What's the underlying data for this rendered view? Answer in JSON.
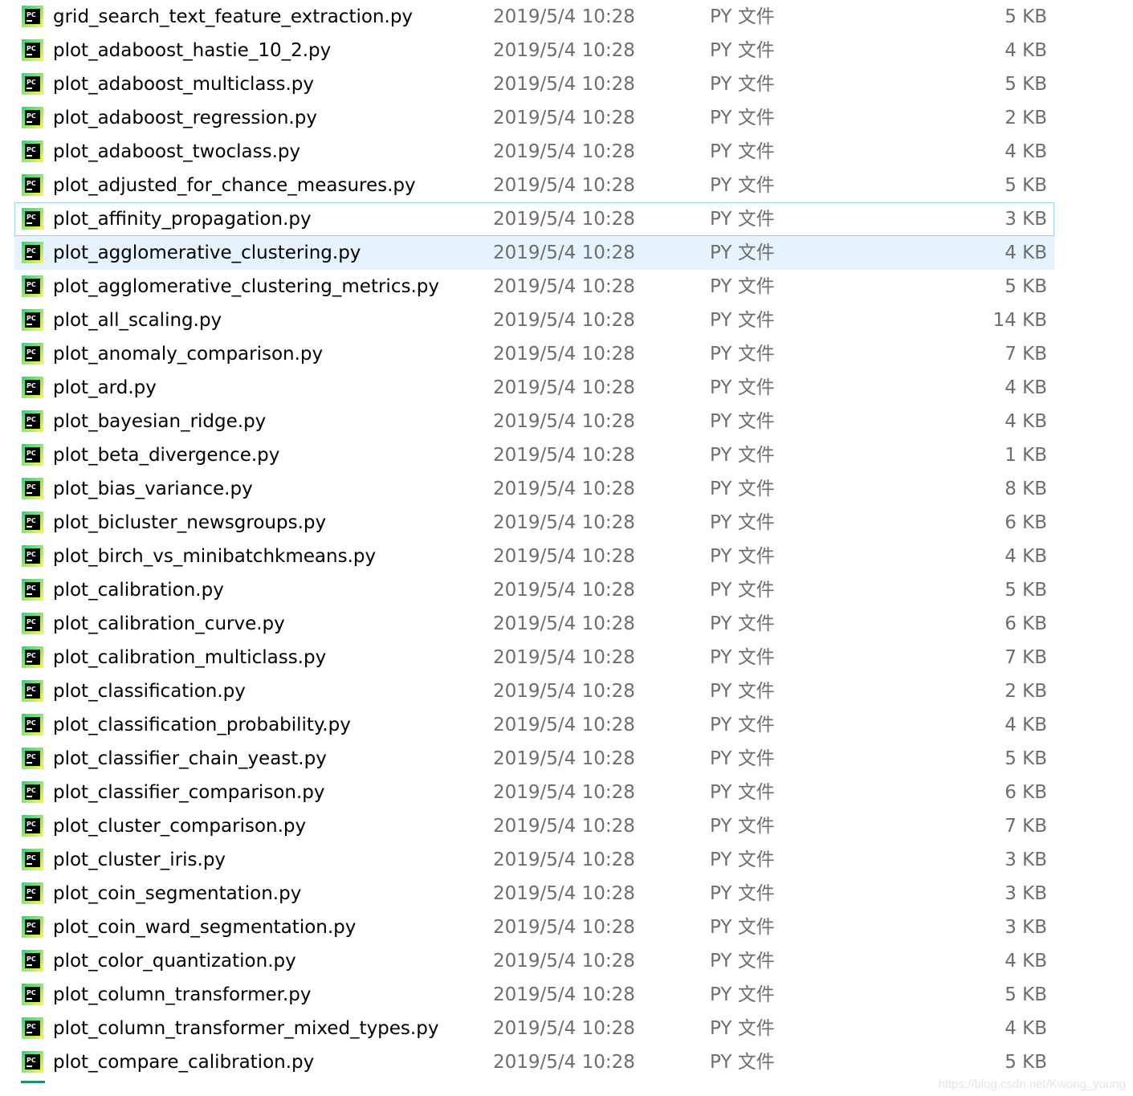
{
  "colors": {
    "focus_border": "#99d1ff",
    "hover_background": "#e5f3ff",
    "name_text": "#000000",
    "detail_text": "#6d6d6d",
    "icon_gradient_top": "#21d789",
    "icon_gradient_bottom": "#fcf84a"
  },
  "file_icon": "pycharm-py-file-icon",
  "files": [
    {
      "name": "grid_search_text_feature_extraction.py",
      "date": "2019/5/4 10:28",
      "type": "PY 文件",
      "size": "5 KB"
    },
    {
      "name": "plot_adaboost_hastie_10_2.py",
      "date": "2019/5/4 10:28",
      "type": "PY 文件",
      "size": "4 KB"
    },
    {
      "name": "plot_adaboost_multiclass.py",
      "date": "2019/5/4 10:28",
      "type": "PY 文件",
      "size": "5 KB"
    },
    {
      "name": "plot_adaboost_regression.py",
      "date": "2019/5/4 10:28",
      "type": "PY 文件",
      "size": "2 KB"
    },
    {
      "name": "plot_adaboost_twoclass.py",
      "date": "2019/5/4 10:28",
      "type": "PY 文件",
      "size": "4 KB"
    },
    {
      "name": "plot_adjusted_for_chance_measures.py",
      "date": "2019/5/4 10:28",
      "type": "PY 文件",
      "size": "5 KB"
    },
    {
      "name": "plot_affinity_propagation.py",
      "date": "2019/5/4 10:28",
      "type": "PY 文件",
      "size": "3 KB",
      "state": "focused"
    },
    {
      "name": "plot_agglomerative_clustering.py",
      "date": "2019/5/4 10:28",
      "type": "PY 文件",
      "size": "4 KB",
      "state": "hovered"
    },
    {
      "name": "plot_agglomerative_clustering_metrics.py",
      "date": "2019/5/4 10:28",
      "type": "PY 文件",
      "size": "5 KB"
    },
    {
      "name": "plot_all_scaling.py",
      "date": "2019/5/4 10:28",
      "type": "PY 文件",
      "size": "14 KB"
    },
    {
      "name": "plot_anomaly_comparison.py",
      "date": "2019/5/4 10:28",
      "type": "PY 文件",
      "size": "7 KB"
    },
    {
      "name": "plot_ard.py",
      "date": "2019/5/4 10:28",
      "type": "PY 文件",
      "size": "4 KB"
    },
    {
      "name": "plot_bayesian_ridge.py",
      "date": "2019/5/4 10:28",
      "type": "PY 文件",
      "size": "4 KB"
    },
    {
      "name": "plot_beta_divergence.py",
      "date": "2019/5/4 10:28",
      "type": "PY 文件",
      "size": "1 KB"
    },
    {
      "name": "plot_bias_variance.py",
      "date": "2019/5/4 10:28",
      "type": "PY 文件",
      "size": "8 KB"
    },
    {
      "name": "plot_bicluster_newsgroups.py",
      "date": "2019/5/4 10:28",
      "type": "PY 文件",
      "size": "6 KB"
    },
    {
      "name": "plot_birch_vs_minibatchkmeans.py",
      "date": "2019/5/4 10:28",
      "type": "PY 文件",
      "size": "4 KB"
    },
    {
      "name": "plot_calibration.py",
      "date": "2019/5/4 10:28",
      "type": "PY 文件",
      "size": "5 KB"
    },
    {
      "name": "plot_calibration_curve.py",
      "date": "2019/5/4 10:28",
      "type": "PY 文件",
      "size": "6 KB"
    },
    {
      "name": "plot_calibration_multiclass.py",
      "date": "2019/5/4 10:28",
      "type": "PY 文件",
      "size": "7 KB"
    },
    {
      "name": "plot_classification.py",
      "date": "2019/5/4 10:28",
      "type": "PY 文件",
      "size": "2 KB"
    },
    {
      "name": "plot_classification_probability.py",
      "date": "2019/5/4 10:28",
      "type": "PY 文件",
      "size": "4 KB"
    },
    {
      "name": "plot_classifier_chain_yeast.py",
      "date": "2019/5/4 10:28",
      "type": "PY 文件",
      "size": "5 KB"
    },
    {
      "name": "plot_classifier_comparison.py",
      "date": "2019/5/4 10:28",
      "type": "PY 文件",
      "size": "6 KB"
    },
    {
      "name": "plot_cluster_comparison.py",
      "date": "2019/5/4 10:28",
      "type": "PY 文件",
      "size": "7 KB"
    },
    {
      "name": "plot_cluster_iris.py",
      "date": "2019/5/4 10:28",
      "type": "PY 文件",
      "size": "3 KB"
    },
    {
      "name": "plot_coin_segmentation.py",
      "date": "2019/5/4 10:28",
      "type": "PY 文件",
      "size": "3 KB"
    },
    {
      "name": "plot_coin_ward_segmentation.py",
      "date": "2019/5/4 10:28",
      "type": "PY 文件",
      "size": "3 KB"
    },
    {
      "name": "plot_color_quantization.py",
      "date": "2019/5/4 10:28",
      "type": "PY 文件",
      "size": "4 KB"
    },
    {
      "name": "plot_column_transformer.py",
      "date": "2019/5/4 10:28",
      "type": "PY 文件",
      "size": "5 KB"
    },
    {
      "name": "plot_column_transformer_mixed_types.py",
      "date": "2019/5/4 10:28",
      "type": "PY 文件",
      "size": "4 KB"
    },
    {
      "name": "plot_compare_calibration.py",
      "date": "2019/5/4 10:28",
      "type": "PY 文件",
      "size": "5 KB"
    }
  ],
  "watermark": "https://blog.csdn.net/Kwong_young"
}
